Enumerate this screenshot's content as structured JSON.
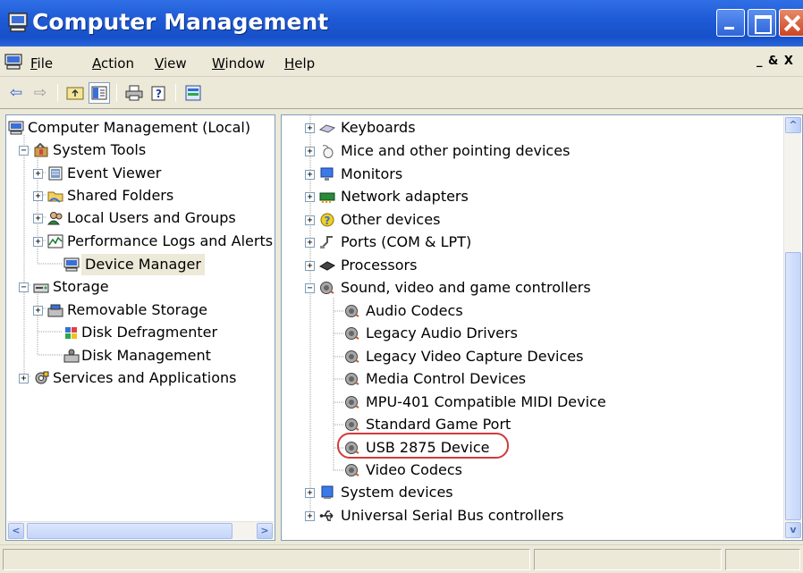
{
  "window": {
    "title": "Computer Management"
  },
  "menu": {
    "items": [
      {
        "label": "File",
        "u": "F",
        "rest": "ile"
      },
      {
        "label": "Action",
        "u": "A",
        "rest": "ction"
      },
      {
        "label": "View",
        "u": "V",
        "rest": "iew"
      },
      {
        "label": "Window",
        "u": "W",
        "rest": "indow"
      },
      {
        "label": "Help",
        "u": "H",
        "rest": "elp"
      }
    ],
    "mdi_controls": "_ & X"
  },
  "toolbar": {
    "buttons": [
      "back-arrow-icon",
      "forward-arrow-icon",
      "up-folder-icon",
      "show-hide-tree-icon",
      "print-icon",
      "help-icon",
      "properties-icon"
    ]
  },
  "left_tree": {
    "root": "Computer Management (Local)",
    "system_tools": "System Tools",
    "event_viewer": "Event Viewer",
    "shared_folders": "Shared Folders",
    "local_users": "Local Users and Groups",
    "perf_logs": "Performance Logs and Alerts",
    "device_manager": "Device Manager",
    "storage": "Storage",
    "removable_storage": "Removable Storage",
    "disk_defrag": "Disk Defragmenter",
    "disk_mgmt": "Disk Management",
    "services_apps": "Services and Applications"
  },
  "device_tree": {
    "keyboards": "Keyboards",
    "mice": "Mice and other pointing devices",
    "monitors": "Monitors",
    "network": "Network adapters",
    "other": "Other devices",
    "ports": "Ports (COM & LPT)",
    "processors": "Processors",
    "sound": "Sound, video and game controllers",
    "sound_children": [
      "Audio Codecs",
      "Legacy Audio Drivers",
      "Legacy Video Capture Devices",
      "Media Control Devices",
      "MPU-401 Compatible MIDI Device",
      "Standard Game Port",
      "USB 2875 Device",
      "Video Codecs"
    ],
    "system_devices": "System devices",
    "usb_controllers": "Universal Serial Bus controllers"
  },
  "colors": {
    "titlebar": "#1f5bd6",
    "highlight_circle": "#d23a3a",
    "chrome": "#ece9d8"
  }
}
